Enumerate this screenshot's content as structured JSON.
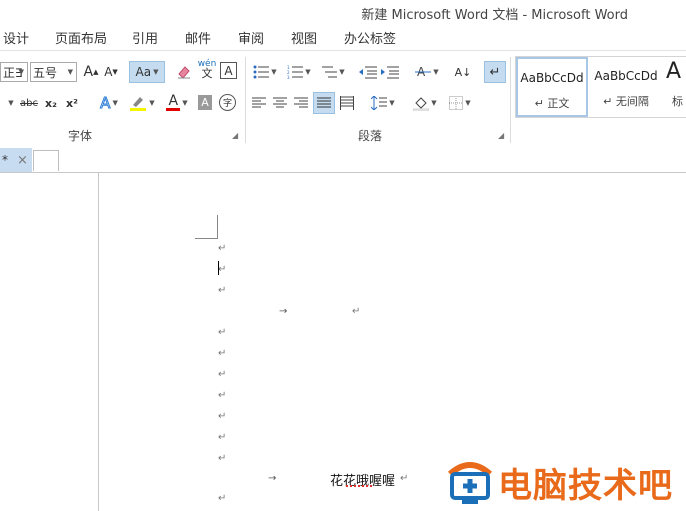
{
  "window": {
    "title": "新建 Microsoft Word 文档 - Microsoft Word"
  },
  "ribbon_tabs": [
    "设计",
    "页面布局",
    "引用",
    "邮件",
    "审阅",
    "视图",
    "办公标签"
  ],
  "font_group": {
    "font_name": "正∃",
    "font_size": "五号",
    "grow_label": "A",
    "shrink_label": "A",
    "case_label": "Aa",
    "phonetic_label": "wén",
    "border_char_label": "A",
    "strike_label": "abc",
    "sub_label": "x₂",
    "sup_label": "x²",
    "effects_label": "A",
    "font_color_label": "A",
    "shade_label": "A",
    "enclose_label": "字",
    "label": "字体"
  },
  "paragraph_group": {
    "label": "段落",
    "sort_label": "A↓"
  },
  "styles_group": {
    "items": [
      {
        "sample": "AaBbCcDd",
        "name": "↵ 正文"
      },
      {
        "sample": "AaBbCcDd",
        "name": "↵ 无间隔"
      },
      {
        "sample": "A",
        "name": "标"
      }
    ]
  },
  "doc_tabs": {
    "active_label": "*",
    "close": "×"
  },
  "document": {
    "para_mark": "↵",
    "tab_mark": "→",
    "text_line": "花花哦喔喔"
  },
  "watermark": {
    "text": "电脑技术吧"
  },
  "colors": {
    "accent": "#e86a1a",
    "selection": "#c5dcf0",
    "logo_blue": "#1b6fb8"
  }
}
